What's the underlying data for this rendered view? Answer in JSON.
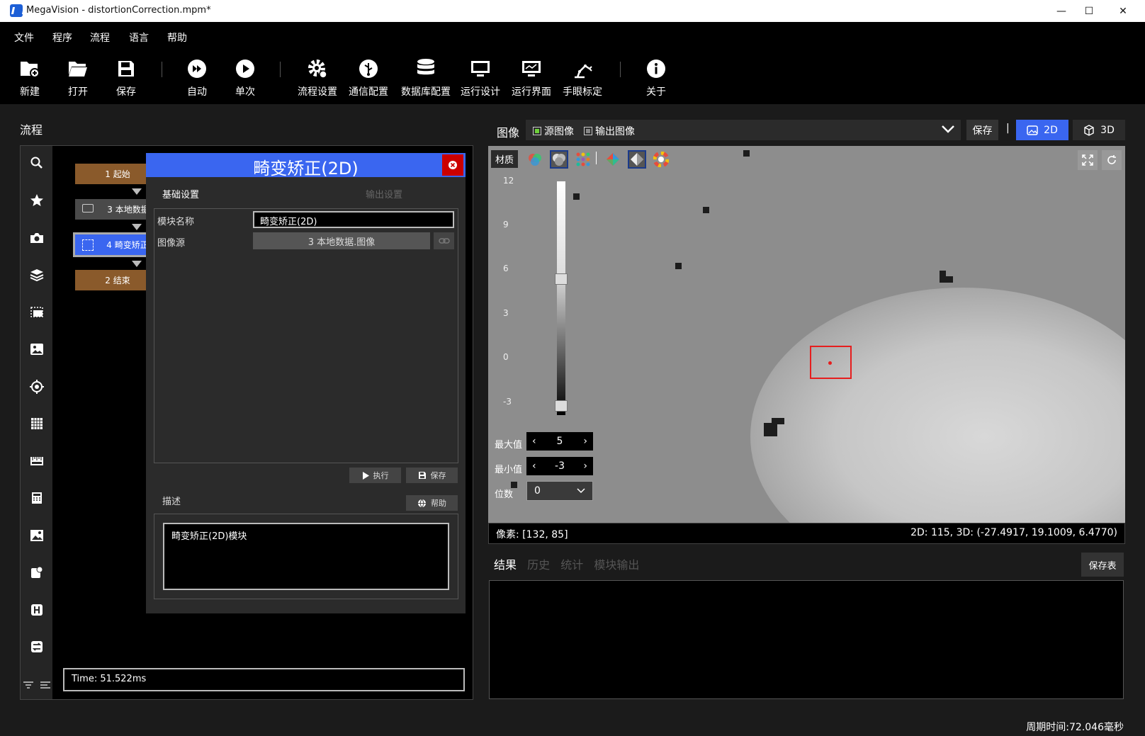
{
  "window": {
    "title": "MegaVision - distortionCorrection.mpm*",
    "minimize": "—",
    "maximize": "☐",
    "close": "✕"
  },
  "menu": [
    "文件",
    "程序",
    "流程",
    "语言",
    "帮助"
  ],
  "toolbar": {
    "new": "新建",
    "open": "打开",
    "save": "保存",
    "auto": "自动",
    "single": "单次",
    "flow_settings": "流程设置",
    "comm_config": "通信配置",
    "db_config": "数据库配置",
    "run_design": "运行设计",
    "run_ui": "运行界面",
    "hand_eye": "手眼标定",
    "about": "关于"
  },
  "flow": {
    "title": "流程",
    "nodes": [
      "1 起始",
      "3 本地数据",
      "4 畸变矫正",
      "2 结束"
    ],
    "time": "Time: 51.522ms"
  },
  "dialog": {
    "title": "畸变矫正(2D)",
    "tab_basic": "基础设置",
    "tab_output": "输出设置",
    "name_label": "模块名称",
    "name_value": "畸变矫正(2D)",
    "source_label": "图像源",
    "source_value": "3 本地数据.图像",
    "run_label": "执行",
    "save_label": "保存",
    "desc_label": "描述",
    "help_label": "帮助",
    "desc_value": "畸变矫正(2D)模块"
  },
  "image": {
    "label": "图像",
    "source_image": "源图像",
    "output_image": "输出图像",
    "save": "保存",
    "sep": "|",
    "mode_2d": "2D",
    "mode_3d": "3D",
    "material": "材质",
    "ticks": [
      "12",
      "9",
      "6",
      "3",
      "0",
      "-3"
    ],
    "max_label": "最大值",
    "max_value": "5",
    "min_label": "最小值",
    "min_value": "-3",
    "digits_label": "位数",
    "digits_value": "0",
    "pixel": "像素: [132, 85]",
    "values": "2D: 115, 3D: (-27.4917, 19.1009, 6.4770)"
  },
  "results": {
    "tabs": [
      "结果",
      "历史",
      "统计",
      "模块输出"
    ],
    "save_table": "保存表"
  },
  "status": {
    "cycle_time": "周期时间:72.046毫秒"
  },
  "colors": {
    "accent": "#3a66f0",
    "node_brown": "#8a5a2b",
    "node_gray": "#4a4a4a",
    "close_red": "#cc0000"
  }
}
